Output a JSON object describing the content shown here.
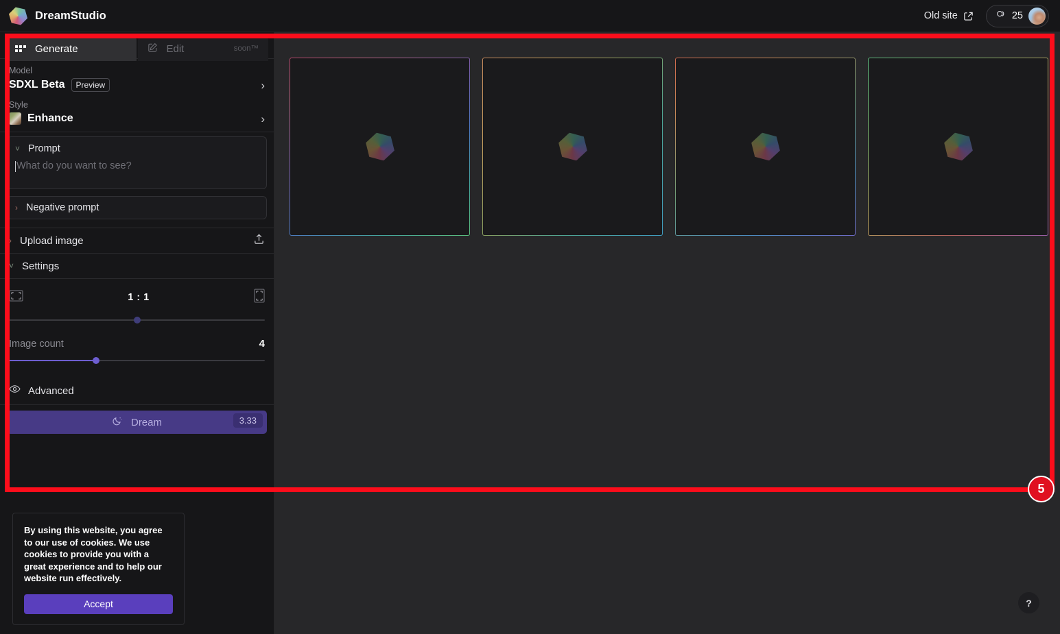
{
  "header": {
    "brand": "DreamStudio",
    "logo_icon": "hexagon-gradient-logo",
    "old_site_label": "Old site",
    "external_link_icon": "external-link-icon",
    "credits": "25",
    "credits_icon": "coins-icon",
    "avatar_icon": "user-avatar"
  },
  "sidebar": {
    "tabs": [
      {
        "label": "Generate",
        "icon": "grid-icon",
        "active": true,
        "badge": ""
      },
      {
        "label": "Edit",
        "icon": "pencil-square-icon",
        "active": false,
        "badge": "soon™"
      }
    ],
    "model": {
      "label": "Model",
      "value": "SDXL Beta",
      "badge": "Preview",
      "chevron": "chevron-right-icon"
    },
    "style": {
      "label": "Style",
      "value": "Enhance",
      "thumb_icon": "style-thumbnail",
      "chevron": "chevron-right-icon"
    },
    "prompt": {
      "label": "Prompt",
      "placeholder": "What do you want to see?",
      "value": "",
      "chevron": "chevron-down-icon"
    },
    "negative_prompt": {
      "label": "Negative prompt",
      "chevron": "chevron-right-icon"
    },
    "upload_image": {
      "label": "Upload image",
      "chevron": "chevron-right-icon",
      "action_icon": "upload-icon"
    },
    "settings": {
      "label": "Settings",
      "chevron": "chevron-down-icon",
      "aspect_ratio": {
        "value": "1 : 1",
        "left_icon": "landscape-frame-icon",
        "right_icon": "portrait-frame-icon",
        "slider_percent": 50
      },
      "image_count": {
        "label": "Image count",
        "value": "4",
        "slider_percent": 34
      }
    },
    "advanced": {
      "label": "Advanced",
      "icon": "eye-icon"
    },
    "dream": {
      "label": "Dream",
      "icon": "moon-stars-icon",
      "cost": "3.33"
    }
  },
  "cookie_banner": {
    "text": "By using this website, you agree to our use of cookies. We use cookies to provide you with a great experience and to help our website run effectively.",
    "accept_label": "Accept"
  },
  "canvas": {
    "placeholders": [
      {
        "icon": "hexagon-gradient-placeholder"
      },
      {
        "icon": "hexagon-gradient-placeholder"
      },
      {
        "icon": "hexagon-gradient-placeholder"
      },
      {
        "icon": "hexagon-gradient-placeholder"
      }
    ],
    "help_label": "?"
  },
  "annotation": {
    "badge_number": "5",
    "color": "#fc0d1b"
  },
  "colors": {
    "accent_purple": "#5a3fbd",
    "dream_purple": "#473a86",
    "sidebar_bg": "#161618",
    "canvas_bg": "#272729",
    "annotation_red": "#fc0d1b"
  }
}
